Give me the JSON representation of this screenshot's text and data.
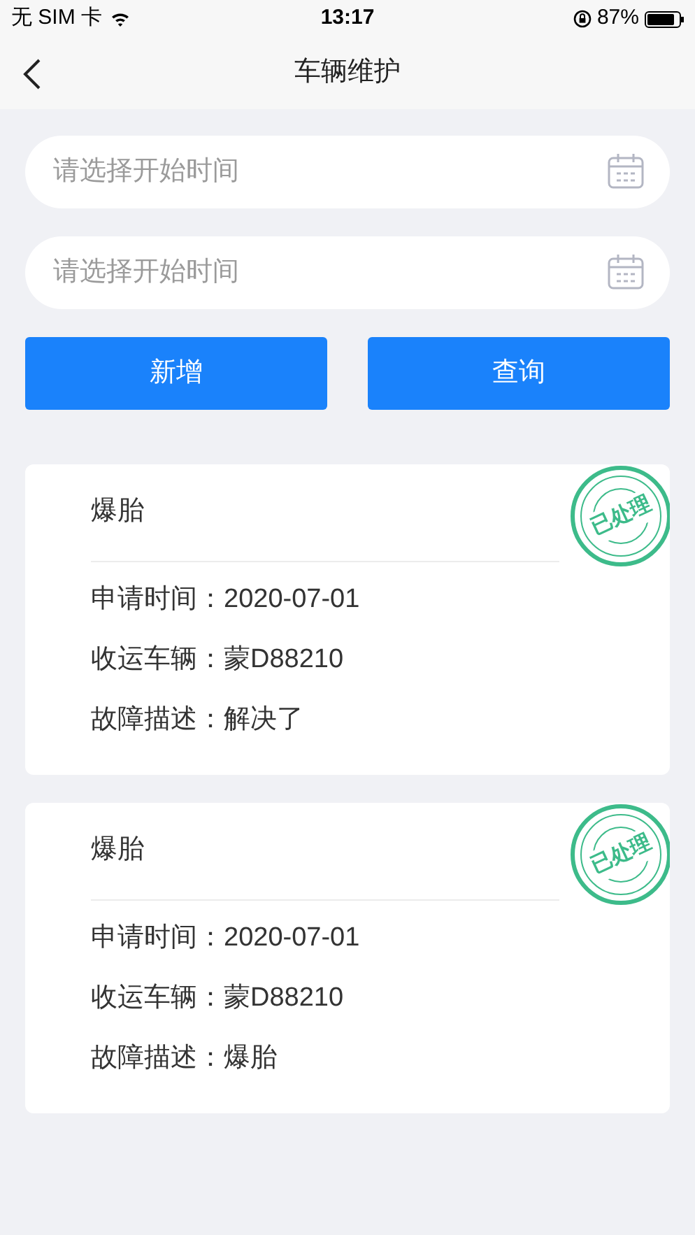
{
  "status_bar": {
    "carrier": "无 SIM 卡",
    "time": "13:17",
    "battery": "87%"
  },
  "nav": {
    "title": "车辆维护"
  },
  "fields": [
    {
      "placeholder": "请选择开始时间"
    },
    {
      "placeholder": "请选择开始时间"
    }
  ],
  "buttons": [
    "新增",
    "查询"
  ],
  "records": [
    {
      "title": "爆胎",
      "stamp": "已处理",
      "rows": [
        {
          "label": "申请时间：",
          "value": "2020-07-01"
        },
        {
          "label": "收运车辆：",
          "value": "蒙D88210"
        },
        {
          "label": "故障描述：",
          "value": "解决了"
        }
      ]
    },
    {
      "title": "爆胎",
      "stamp": "已处理",
      "rows": [
        {
          "label": "申请时间：",
          "value": "2020-07-01"
        },
        {
          "label": "收运车辆：",
          "value": "蒙D88210"
        },
        {
          "label": "故障描述：",
          "value": "爆胎"
        }
      ]
    }
  ]
}
